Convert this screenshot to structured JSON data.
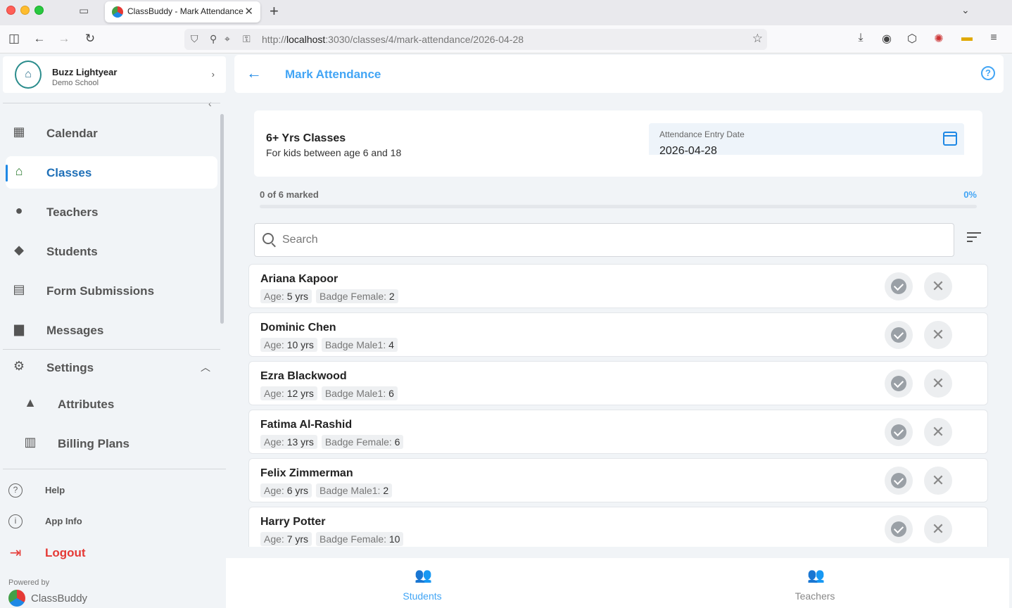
{
  "browser": {
    "tab_title": "ClassBuddy - Mark Attendance",
    "url_prefix": "http://",
    "url_host": "localhost",
    "url_path": ":3030/classes/4/mark-attendance/2026-04-28"
  },
  "profile": {
    "name": "Buzz Lightyear",
    "school": "Demo School"
  },
  "sidebar": {
    "items": [
      {
        "label": "Calendar",
        "icon": "calendar-icon"
      },
      {
        "label": "Classes",
        "icon": "classes-icon"
      },
      {
        "label": "Teachers",
        "icon": "person-icon"
      },
      {
        "label": "Students",
        "icon": "graduation-cap-icon"
      },
      {
        "label": "Form Submissions",
        "icon": "clipboard-icon"
      },
      {
        "label": "Messages",
        "icon": "chat-icon"
      },
      {
        "label": "Settings",
        "icon": "gear-icon"
      },
      {
        "label": "Attributes",
        "icon": "shapes-icon"
      },
      {
        "label": "Billing Plans",
        "icon": "receipt-icon"
      }
    ],
    "active": "Classes",
    "footer": {
      "help": "Help",
      "app_info": "App Info",
      "logout": "Logout",
      "powered_by": "Powered by",
      "brand": "ClassBuddy"
    }
  },
  "header": {
    "title": "Mark Attendance"
  },
  "class_info": {
    "name": "6+ Yrs Classes",
    "description": "For kids between age 6 and 18",
    "date_label": "Attendance Entry Date",
    "date_value": "2026-04-28"
  },
  "progress": {
    "label": "0 of 6 marked",
    "percent_label": "0%",
    "fraction": 0
  },
  "search": {
    "placeholder": "Search",
    "value": ""
  },
  "students": [
    {
      "name": "Ariana Kapoor",
      "age_key": "Age:",
      "age_val": "5 yrs",
      "badge_key": "Badge Female:",
      "badge_val": "2"
    },
    {
      "name": "Dominic Chen",
      "age_key": "Age:",
      "age_val": "10 yrs",
      "badge_key": "Badge Male1:",
      "badge_val": "4"
    },
    {
      "name": "Ezra Blackwood",
      "age_key": "Age:",
      "age_val": "12 yrs",
      "badge_key": "Badge Male1:",
      "badge_val": "6"
    },
    {
      "name": "Fatima Al-Rashid",
      "age_key": "Age:",
      "age_val": "13 yrs",
      "badge_key": "Badge Female:",
      "badge_val": "6"
    },
    {
      "name": "Felix Zimmerman",
      "age_key": "Age:",
      "age_val": "6 yrs",
      "badge_key": "Badge Male1:",
      "badge_val": "2"
    },
    {
      "name": "Harry Potter",
      "age_key": "Age:",
      "age_val": "7 yrs",
      "badge_key": "Badge Female:",
      "badge_val": "10"
    }
  ],
  "bottom_nav": {
    "students": "Students",
    "teachers": "Teachers",
    "active": "Students"
  },
  "colors": {
    "accent": "#42a5f5",
    "active_nav": "#1e6fb7",
    "logout": "#e53935"
  }
}
